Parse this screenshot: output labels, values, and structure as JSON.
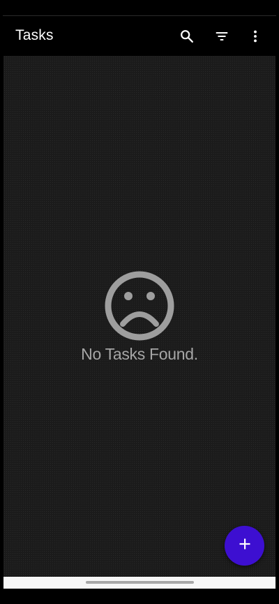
{
  "app_bar": {
    "title": "Tasks",
    "actions": [
      {
        "icon": "search-icon"
      },
      {
        "icon": "filter-icon"
      },
      {
        "icon": "more-vert-icon"
      }
    ]
  },
  "empty_state": {
    "icon": "sad-face-icon",
    "message": "No Tasks Found."
  },
  "fab": {
    "icon": "plus-icon"
  },
  "colors": {
    "app_bar_bg": "#000000",
    "content_bg": "#1b1b1b",
    "empty_text": "#a6a6a6",
    "fab_bg": "#3d0fd1",
    "nav_bar_bg": "#f7f7f7"
  }
}
